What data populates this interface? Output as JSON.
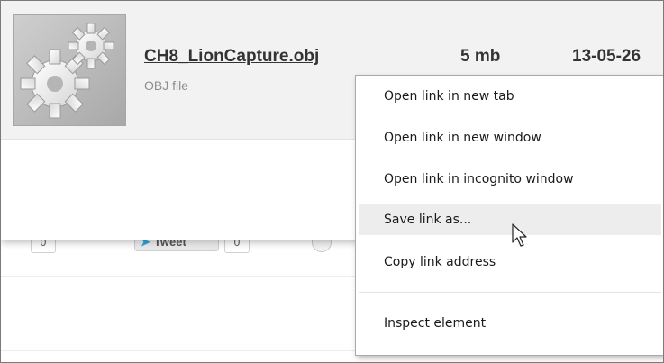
{
  "file": {
    "name": "CH8_LionCapture.obj",
    "type": "OBJ file",
    "size": "5 mb",
    "date": "13-05-26",
    "thumbnail_icon": "gears-icon"
  },
  "share": {
    "count_left": "0",
    "tweet_label": "Tweet",
    "tweet_count": "0"
  },
  "context_menu": {
    "items": [
      {
        "label": "Open link in new tab"
      },
      {
        "label": "Open link in new window"
      },
      {
        "label": "Open link in incognito window"
      },
      {
        "label": "Save link as..."
      },
      {
        "label": "Copy link address"
      },
      {
        "label": "Inspect element"
      }
    ],
    "hovered_index": 3
  },
  "colors": {
    "card_bg": "#f2f2f2",
    "hover_bg": "#ededed",
    "tweet_bird": "#2ea7e0"
  }
}
